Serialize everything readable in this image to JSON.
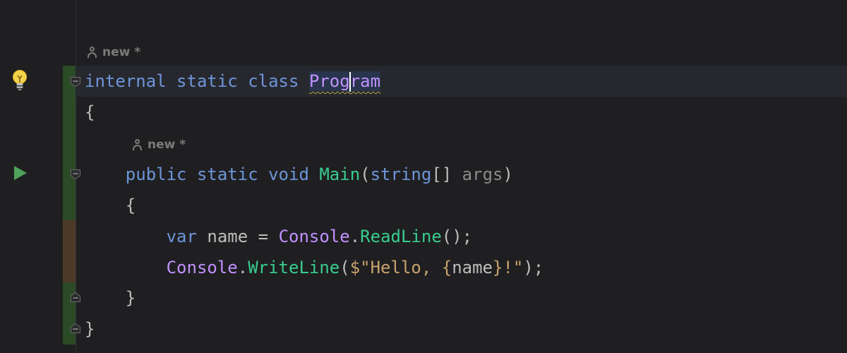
{
  "hints": {
    "class_author": "new *",
    "method_author": "new *"
  },
  "code": {
    "line1": {
      "kw_internal": "internal",
      "kw_static": "static",
      "kw_class": "class",
      "class_name_a": "Prog",
      "class_name_b": "ram"
    },
    "line2": {
      "brace": "{"
    },
    "line3": {
      "kw_public": "public",
      "kw_static": "static",
      "kw_void": "void",
      "method_name": "Main",
      "paren_open": "(",
      "type_string": "string",
      "brackets": "[]",
      "param": "args",
      "paren_close": ")"
    },
    "line4": {
      "brace": "{"
    },
    "line5": {
      "kw_var": "var",
      "ident": "name",
      "assign": "=",
      "cls": "Console",
      "dot": ".",
      "fn": "ReadLine",
      "tail": "();"
    },
    "line6": {
      "cls": "Console",
      "dot": ".",
      "fn": "WriteLine",
      "paren_open": "(",
      "str_start": "$\"Hello, ",
      "interp_open": "{",
      "interp_var": "name",
      "interp_close": "}",
      "str_end": "!\"",
      "tail": ");"
    },
    "line7": {
      "brace": "}"
    },
    "line8": {
      "brace": "}"
    }
  },
  "colors": {
    "background": "#1f1f21",
    "keyword": "#6e95d9",
    "class": "#c191ff",
    "method": "#39cc8f",
    "string": "#c9a26d",
    "vcs_added": "#2b4a26",
    "vcs_modified": "#4e3a28"
  },
  "icons": {
    "gutter_bulb": "lightbulb-icon",
    "gutter_run": "run-icon",
    "fold": "fold-marker-icon",
    "author": "person-icon"
  }
}
